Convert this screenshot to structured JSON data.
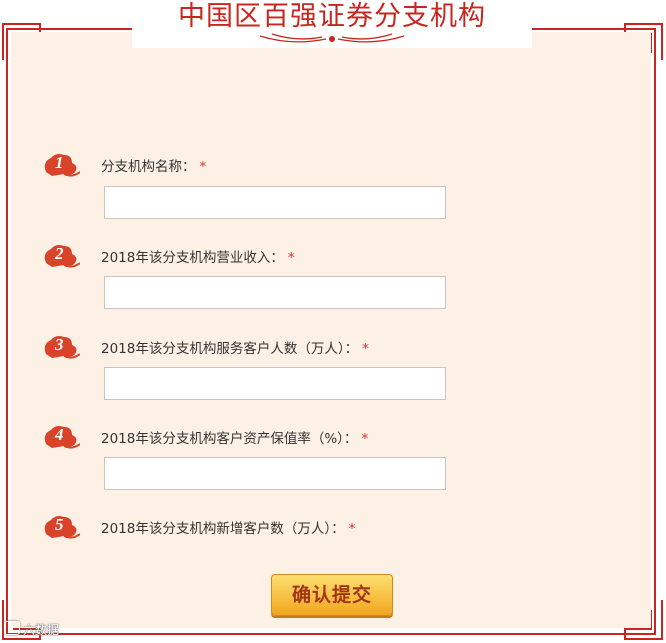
{
  "page_title": "中国区百强证券分支机构",
  "questions": [
    {
      "number": "1",
      "label": "分支机构名称：",
      "required_mark": "*"
    },
    {
      "number": "2",
      "label": "2018年该分支机构营业收入：",
      "required_mark": "*"
    },
    {
      "number": "3",
      "label": "2018年该分支机构服务客户人数（万人）：",
      "required_mark": "*"
    },
    {
      "number": "4",
      "label": "2018年该分支机构客户资产保值率（%）：",
      "required_mark": "*"
    },
    {
      "number": "5",
      "label": "2018年该分支机构新增客户数（万人）：",
      "required_mark": "*"
    }
  ],
  "inputs": [
    "",
    "",
    "",
    ""
  ],
  "submit_label": "确认提交",
  "watermark": "六数据",
  "colors": {
    "frame_red": "#c8261e",
    "panel_bg": "#fdf1e6",
    "badge_red": "#d9432a",
    "button_gold": "#f5b62e"
  }
}
